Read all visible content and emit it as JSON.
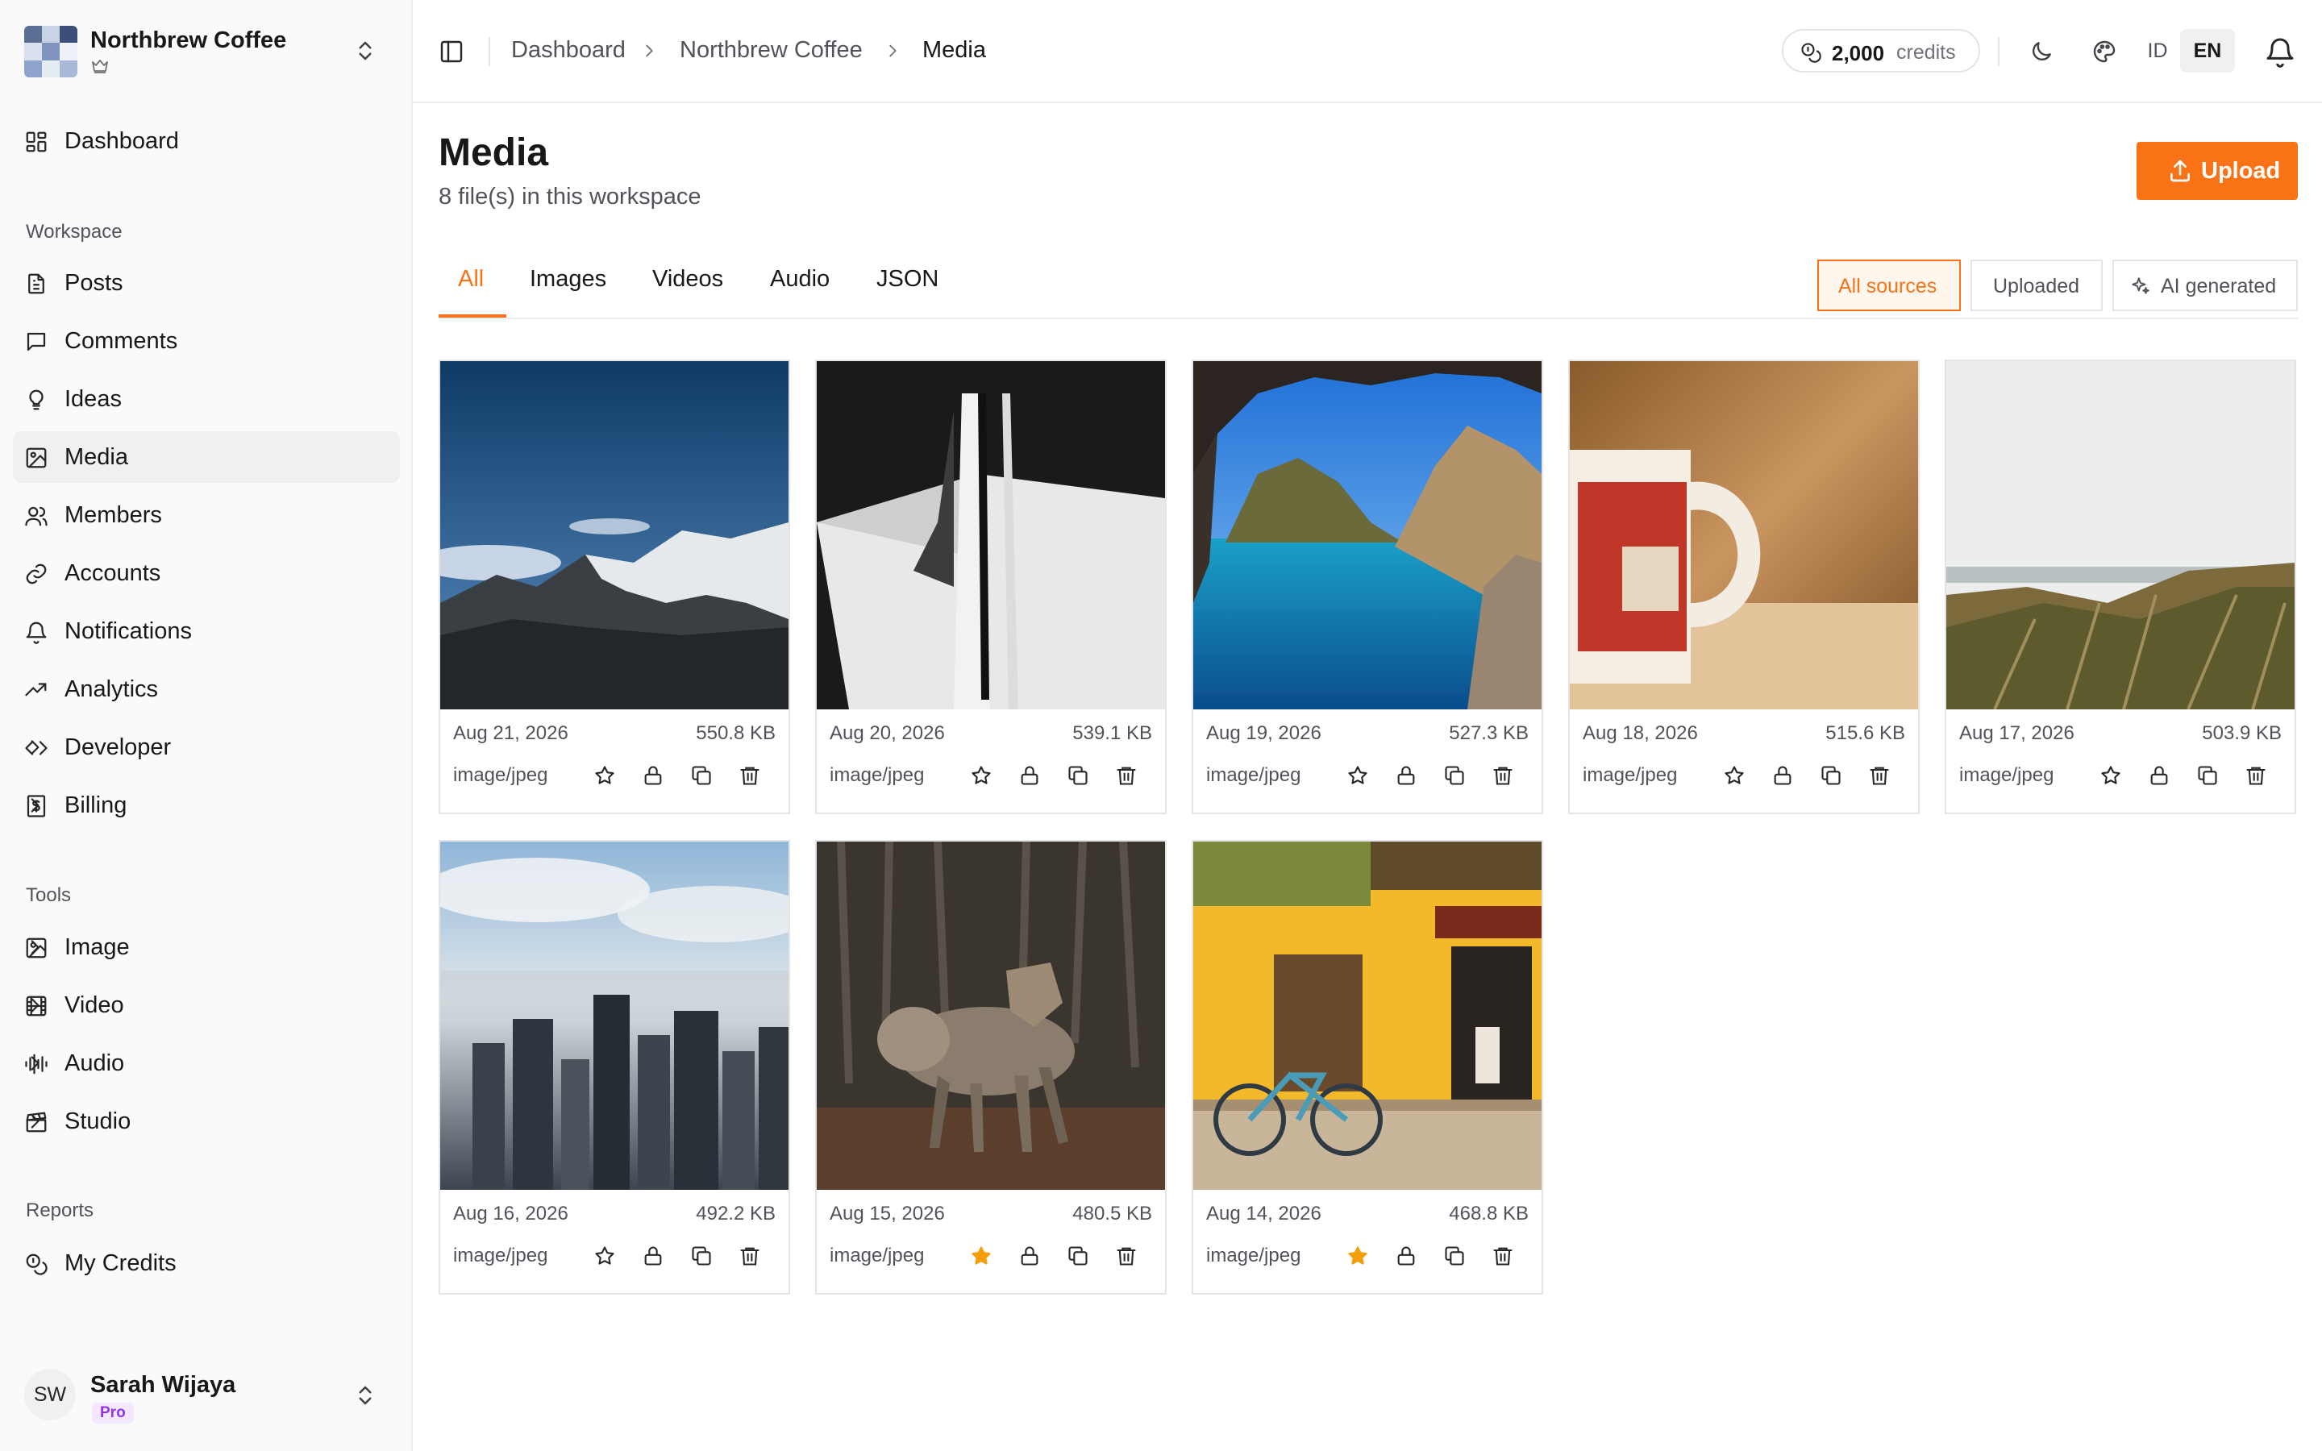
{
  "workspace": {
    "name": "Northbrew Coffee"
  },
  "sidebar": {
    "dashboard": "Dashboard",
    "sections": {
      "workspace": "Workspace",
      "tools": "Tools",
      "reports": "Reports"
    },
    "workspace_items": [
      {
        "label": "Posts",
        "icon": "file-text-icon"
      },
      {
        "label": "Comments",
        "icon": "message-square-icon"
      },
      {
        "label": "Ideas",
        "icon": "lightbulb-icon"
      },
      {
        "label": "Media",
        "icon": "image-icon",
        "active": true
      },
      {
        "label": "Members",
        "icon": "users-icon"
      },
      {
        "label": "Accounts",
        "icon": "link-icon"
      },
      {
        "label": "Notifications",
        "icon": "bell-icon"
      },
      {
        "label": "Analytics",
        "icon": "trending-up-icon"
      },
      {
        "label": "Developer",
        "icon": "code-icon",
        "chevron": true
      },
      {
        "label": "Billing",
        "icon": "receipt-icon",
        "chevron": true
      }
    ],
    "tool_items": [
      {
        "label": "Image",
        "icon": "image-icon",
        "chevron": true
      },
      {
        "label": "Video",
        "icon": "film-icon",
        "chevron": true
      },
      {
        "label": "Audio",
        "icon": "audio-lines-icon",
        "chevron": true
      },
      {
        "label": "Studio",
        "icon": "clapperboard-icon",
        "chevron": true
      }
    ],
    "report_items": [
      {
        "label": "My Credits",
        "icon": "coins-icon"
      }
    ]
  },
  "user": {
    "initials": "SW",
    "name": "Sarah Wijaya",
    "plan": "Pro"
  },
  "header": {
    "breadcrumb": [
      "Dashboard",
      "Northbrew Coffee",
      "Media"
    ],
    "credits_amount": "2,000",
    "credits_label": "credits",
    "lang_id": "ID",
    "lang_en": "EN"
  },
  "page": {
    "title": "Media",
    "subtitle": "8 file(s) in this workspace",
    "upload_label": "Upload"
  },
  "tabs": [
    "All",
    "Images",
    "Videos",
    "Audio",
    "JSON"
  ],
  "active_tab": "All",
  "source_filters": [
    "All sources",
    "Uploaded",
    "AI generated"
  ],
  "active_source": "All sources",
  "media": [
    {
      "date": "Aug 21, 2026",
      "size": "550.8 KB",
      "type": "image/jpeg",
      "starred": false,
      "subject": "snowy mountain range"
    },
    {
      "date": "Aug 20, 2026",
      "size": "539.1 KB",
      "type": "image/jpeg",
      "starred": false,
      "subject": "white architectural fin"
    },
    {
      "date": "Aug 19, 2026",
      "size": "527.3 KB",
      "type": "image/jpeg",
      "starred": false,
      "subject": "sea cave and bay"
    },
    {
      "date": "Aug 18, 2026",
      "size": "515.6 KB",
      "type": "image/jpeg",
      "starred": false,
      "subject": "stamp-print coffee mug"
    },
    {
      "date": "Aug 17, 2026",
      "size": "503.9 KB",
      "type": "image/jpeg",
      "starred": false,
      "subject": "beach dune grass"
    },
    {
      "date": "Aug 16, 2026",
      "size": "492.2 KB",
      "type": "image/jpeg",
      "starred": false,
      "subject": "misty city skyline"
    },
    {
      "date": "Aug 15, 2026",
      "size": "480.5 KB",
      "type": "image/jpeg",
      "starred": true,
      "subject": "coyote in forest"
    },
    {
      "date": "Aug 14, 2026",
      "size": "468.8 KB",
      "type": "image/jpeg",
      "starred": true,
      "subject": "yellow house with bicycle"
    }
  ],
  "colors": {
    "accent": "#f97316",
    "star_active": "#f59e0b",
    "pro_badge": "#9333ea"
  }
}
